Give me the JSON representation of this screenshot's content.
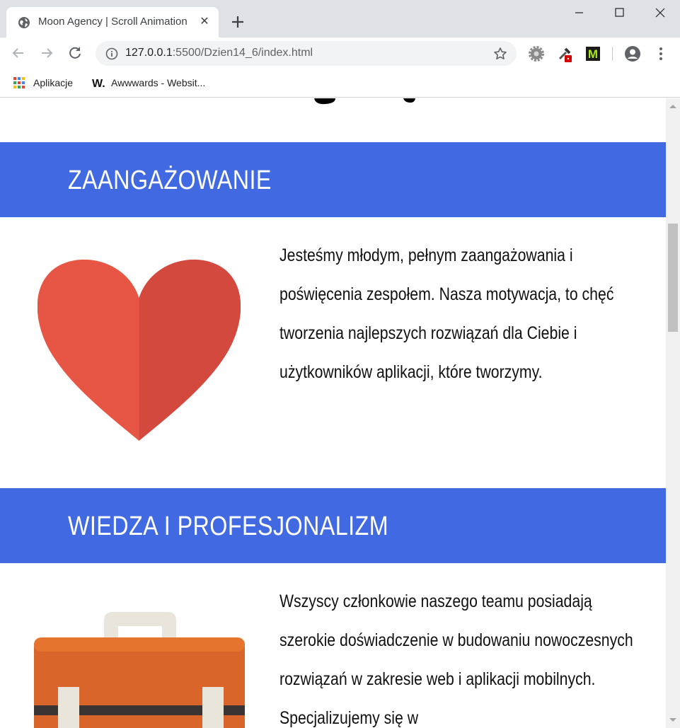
{
  "browser": {
    "tab_title": "Moon Agency | Scroll Animation",
    "url_host": "127.0.0.1",
    "url_rest": ":5500/Dzien14_6/index.html",
    "bookmarks": [
      {
        "label": "Aplikacje",
        "icon": "apps-grid-icon"
      },
      {
        "label": "Awwwards - Websit...",
        "icon": "awwwards-w-icon"
      }
    ]
  },
  "page": {
    "sections": [
      {
        "heading": "ZAANGAŻOWANIE",
        "icon": "heart-icon",
        "text": "Jesteśmy młodym, pełnym zaangażowania i poświęcenia zespołem. Nasza motywacja, to chęć tworzenia najlepszych rozwiązań dla Ciebie i użytkowników aplikacji, które tworzymy."
      },
      {
        "heading": "WIEDZA I PROFESJONALIZM",
        "icon": "briefcase-icon",
        "text": "Wszyscy członkowie naszego teamu posiadają szerokie doświadczenie w budowaniu nowoczesnych rozwiązań w zakresie web i aplikacji mobilnych. Specjalizujemy się w"
      }
    ]
  },
  "colors": {
    "section_bar": "#4169e1",
    "heart_left": "#e75645",
    "heart_right": "#d3493e",
    "briefcase_body": "#d9652b",
    "briefcase_handle": "#e9e5da"
  }
}
